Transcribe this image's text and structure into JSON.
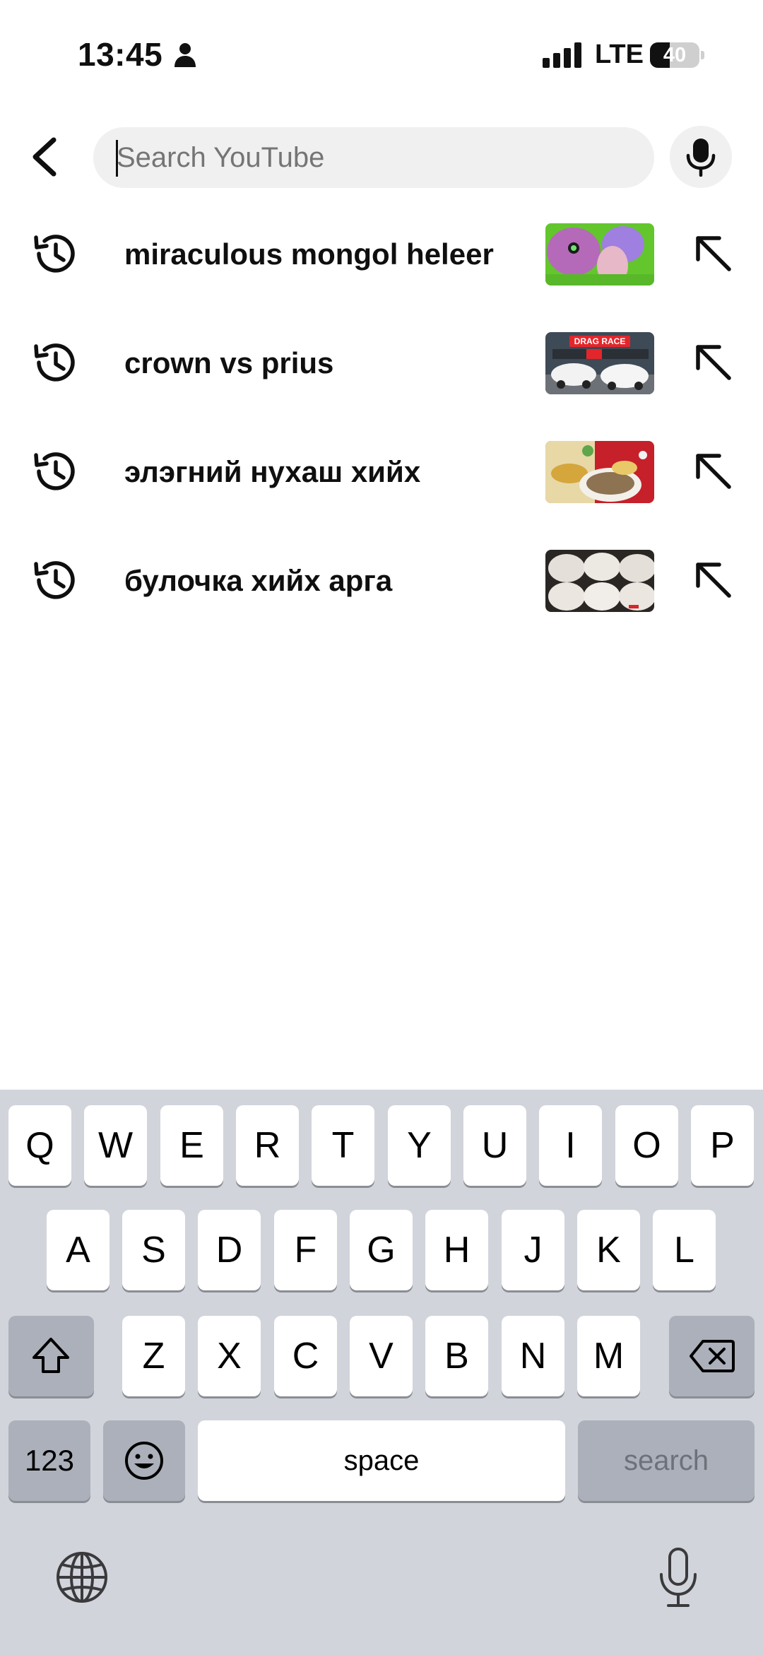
{
  "status_bar": {
    "time": "13:45",
    "network": "LTE",
    "battery_level": "40",
    "battery_fraction": 0.4
  },
  "search": {
    "placeholder": "Search YouTube",
    "value": ""
  },
  "suggestions": [
    {
      "label": "miraculous mongol heleer",
      "thumb_icon": "miraculous-thumbnail"
    },
    {
      "label": "crown vs prius",
      "thumb_icon": "drag-race-thumbnail",
      "thumb_text": "DRAG RACE"
    },
    {
      "label": "элэгний нухаш хийх",
      "thumb_icon": "pate-thumbnail"
    },
    {
      "label": "булочка хийх арга",
      "thumb_icon": "buns-thumbnail"
    }
  ],
  "keyboard": {
    "row1": [
      "Q",
      "W",
      "E",
      "R",
      "T",
      "Y",
      "U",
      "I",
      "O",
      "P"
    ],
    "row2": [
      "A",
      "S",
      "D",
      "F",
      "G",
      "H",
      "J",
      "K",
      "L"
    ],
    "row3": [
      "Z",
      "X",
      "C",
      "V",
      "B",
      "N",
      "M"
    ],
    "numbers_label": "123",
    "space_label": "space",
    "search_label": "search"
  },
  "colors": {
    "keyboard_bg": "#d1d4db",
    "key_bg": "#ffffff",
    "dark_key_bg": "#abb0ba",
    "search_pill_bg": "#f0f0f0"
  }
}
